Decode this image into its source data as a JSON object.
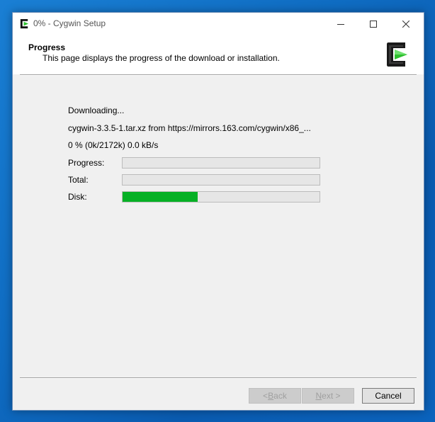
{
  "window": {
    "title": "0% - Cygwin Setup"
  },
  "header": {
    "title": "Progress",
    "subtitle": "This page displays the progress of the download or installation."
  },
  "status": {
    "action": "Downloading...",
    "file": "cygwin-3.3.5-1.tar.xz from https://mirrors.163.com/cygwin/x86_...",
    "stats": "0 %  (0k/2172k)  0.0 kB/s"
  },
  "progress_rows": [
    {
      "label": "Progress:",
      "fraction": 0.0
    },
    {
      "label": "Total:",
      "fraction": 0.0
    },
    {
      "label": "Disk:",
      "fraction": 0.38
    }
  ],
  "buttons": {
    "back_prefix": "< ",
    "back_mnemonic": "B",
    "back_rest": "ack",
    "next_mnemonic": "N",
    "next_rest": "ext >",
    "cancel": "Cancel"
  },
  "colors": {
    "progress_fill": "#06b025"
  },
  "icons": {
    "app": "cygwin-logo-icon",
    "minimize": "minimize-icon",
    "maximize": "maximize-icon",
    "close": "close-icon"
  }
}
